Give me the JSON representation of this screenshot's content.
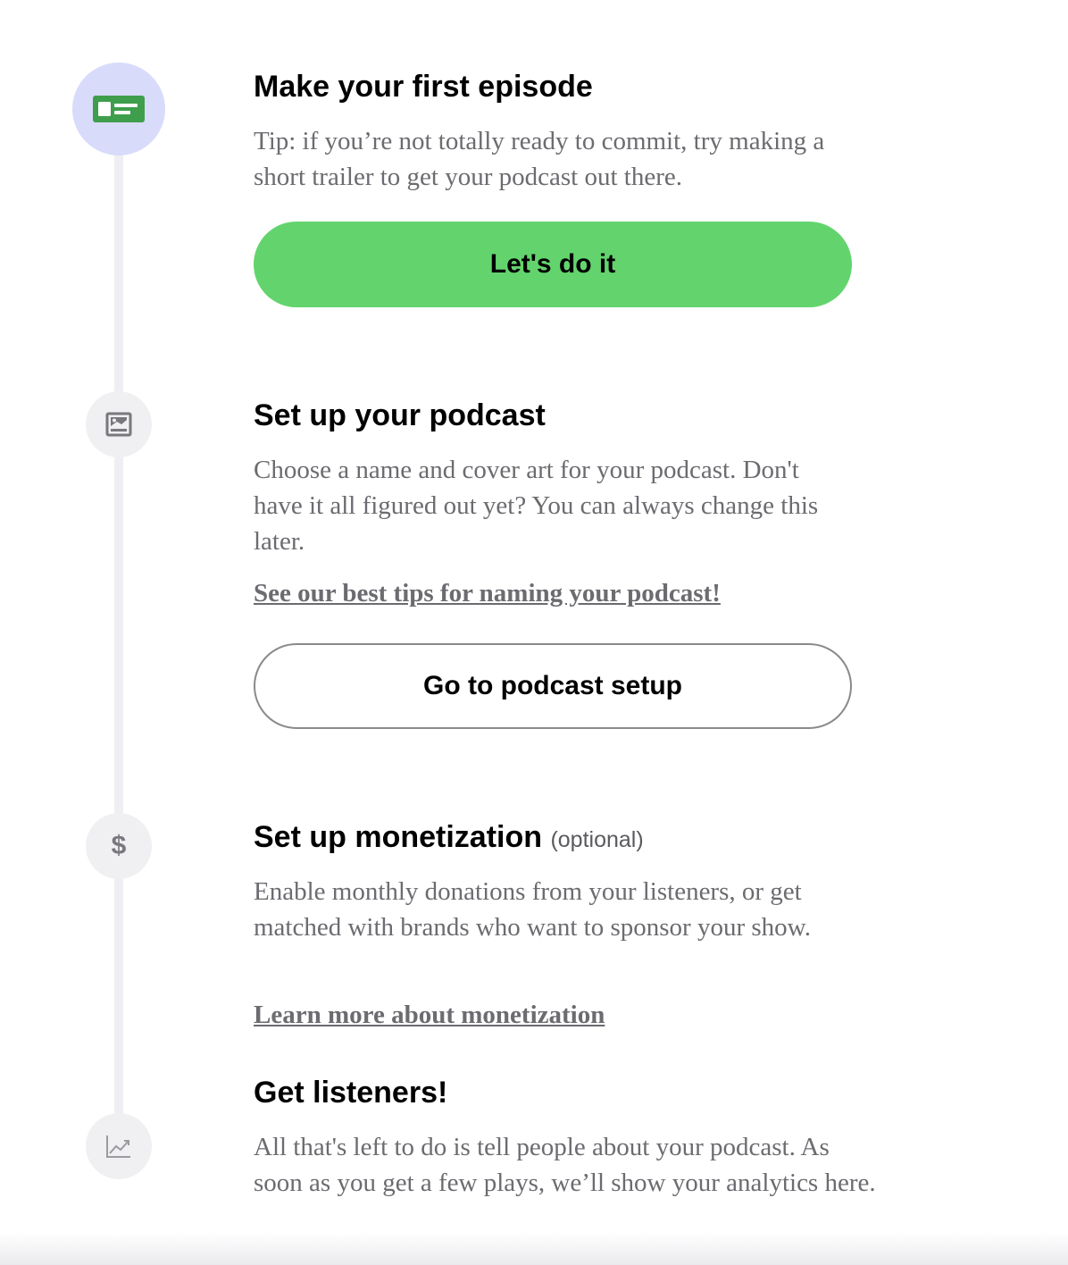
{
  "steps": [
    {
      "title": "Make your first episode",
      "description": "Tip: if you’re not totally ready to commit, try making a short trailer to get your podcast out there.",
      "button_label": "Let's do it",
      "icon": "episode-card-icon",
      "status": "active"
    },
    {
      "title": "Set up your podcast",
      "description": "Choose a name and cover art for your podcast. Don't have it all figured out yet? You can always change this later.",
      "link_label": "See our best tips for naming your podcast!",
      "button_label": "Go to podcast setup",
      "icon": "image-icon"
    },
    {
      "title": "Set up monetization",
      "title_suffix": "(optional)",
      "description": "Enable monthly donations from your listeners, or get matched with brands who want to sponsor your show.",
      "link_label": "Learn more about monetization",
      "icon_glyph": "$",
      "icon": "dollar-icon"
    },
    {
      "title": "Get listeners!",
      "description": "All that's left to do is tell people about your podcast. As soon as you get a few plays, we’ll show your analytics here.",
      "icon": "analytics-chart-icon"
    }
  ],
  "colors": {
    "primary_button": "#63d46d",
    "active_step_bg": "#d9dbfb",
    "active_icon": "#3f9e4c",
    "inactive_step_bg": "#f0f0f2",
    "timeline": "#efeff3",
    "body_text": "#6b6b70"
  }
}
